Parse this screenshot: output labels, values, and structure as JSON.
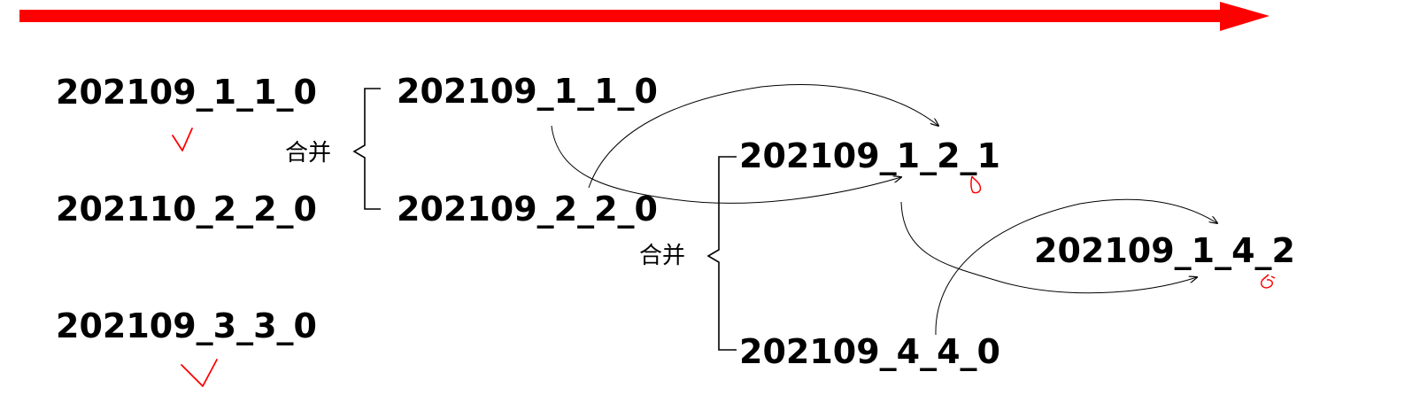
{
  "col1": {
    "item1": "202109_1_1_0",
    "item2": "202110_2_2_0",
    "item3": "202109_3_3_0"
  },
  "col2": {
    "item1": "202109_1_1_0",
    "item2": "202109_2_2_0"
  },
  "col3": {
    "item1": "202109_1_2_1",
    "item2": "202109_4_4_0"
  },
  "col4": {
    "item1": "202109_1_4_2"
  },
  "merge_label_1": "合并",
  "merge_label_2": "合并",
  "colors": {
    "timeline": "#ff0000",
    "annotation": "#ff0000",
    "text": "#000000"
  }
}
